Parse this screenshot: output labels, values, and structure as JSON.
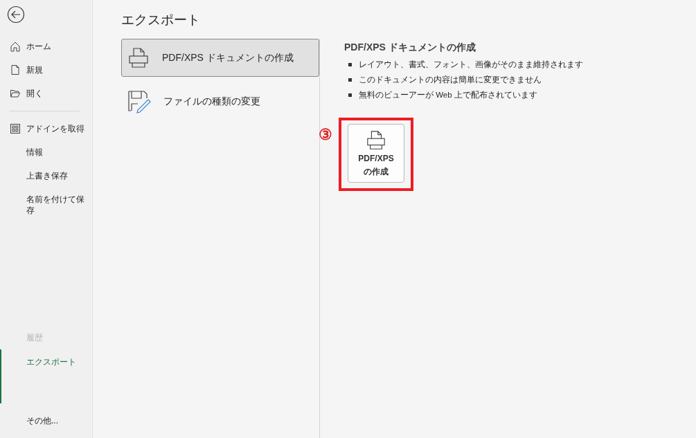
{
  "sidebar": {
    "items": [
      {
        "label": "ホーム",
        "selected": false,
        "disabled": false
      },
      {
        "label": "新規",
        "selected": false,
        "disabled": false
      },
      {
        "label": "開く",
        "selected": false,
        "disabled": false
      },
      {
        "label": "アドインを取得",
        "selected": false,
        "disabled": false
      },
      {
        "label": "情報",
        "selected": false,
        "disabled": false
      },
      {
        "label": "上書き保存",
        "selected": false,
        "disabled": false
      },
      {
        "label": "名前を付けて保存",
        "selected": false,
        "disabled": false
      },
      {
        "label": "履歴",
        "selected": false,
        "disabled": true
      },
      {
        "label": "エクスポート",
        "selected": true,
        "disabled": false
      },
      {
        "label": "その他...",
        "selected": false,
        "disabled": false
      }
    ]
  },
  "page_title": "エクスポート",
  "export_options": [
    {
      "label": "PDF/XPS ドキュメントの作成",
      "selected": true
    },
    {
      "label": "ファイルの種類の変更",
      "selected": false
    }
  ],
  "detail": {
    "heading": "PDF/XPS ドキュメントの作成",
    "bullets": [
      "レイアウト、書式、フォント、画像がそのまま維持されます",
      "このドキュメントの内容は簡単に変更できません",
      "無料のビューアーが Web 上で配布されています"
    ],
    "button": {
      "label_lines": [
        "PDF/XPS",
        "の作成"
      ]
    },
    "annotation": {
      "marker": "③",
      "highlighted": true
    }
  }
}
